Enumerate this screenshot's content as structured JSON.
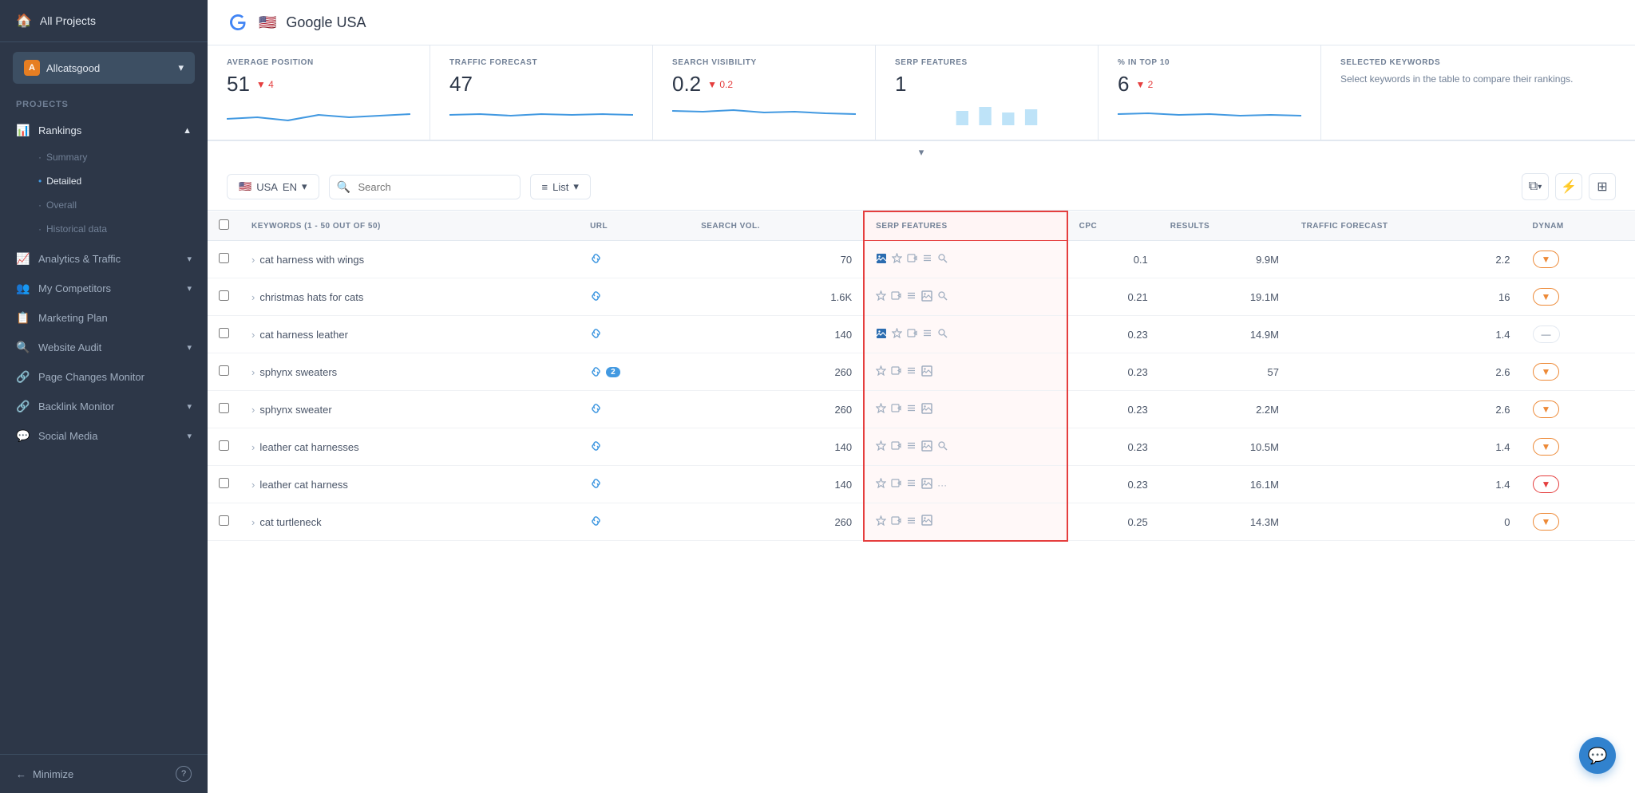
{
  "sidebar": {
    "all_projects_label": "All Projects",
    "project_name": "Allcatsgood",
    "projects_section_label": "PROJECTS",
    "nav_items": [
      {
        "id": "rankings",
        "label": "Rankings",
        "icon": "📊",
        "has_chevron": true,
        "active": true
      },
      {
        "id": "analytics",
        "label": "Analytics & Traffic",
        "icon": "📈",
        "has_chevron": true
      },
      {
        "id": "competitors",
        "label": "My Competitors",
        "icon": "👥",
        "has_chevron": true
      },
      {
        "id": "marketing",
        "label": "Marketing Plan",
        "icon": "📋",
        "has_chevron": false
      },
      {
        "id": "audit",
        "label": "Website Audit",
        "icon": "🔍",
        "has_chevron": true
      },
      {
        "id": "page_monitor",
        "label": "Page Changes Monitor",
        "icon": "🔗",
        "has_chevron": false
      },
      {
        "id": "backlink",
        "label": "Backlink Monitor",
        "icon": "🔗",
        "has_chevron": true
      },
      {
        "id": "social",
        "label": "Social Media",
        "icon": "💬",
        "has_chevron": true
      }
    ],
    "sub_items": [
      {
        "id": "summary",
        "label": "Summary",
        "active": false
      },
      {
        "id": "detailed",
        "label": "Detailed",
        "active": true
      },
      {
        "id": "overall",
        "label": "Overall",
        "active": false
      },
      {
        "id": "historical",
        "label": "Historical data",
        "active": false
      }
    ],
    "minimize_label": "Minimize"
  },
  "header": {
    "engine": "Google",
    "country": "USA",
    "flag": "🇺🇸",
    "title": "Google USA"
  },
  "stats": [
    {
      "label": "AVERAGE POSITION",
      "value": "51",
      "change": "4",
      "change_dir": "down"
    },
    {
      "label": "TRAFFIC FORECAST",
      "value": "47",
      "change": "",
      "change_dir": ""
    },
    {
      "label": "SEARCH VISIBILITY",
      "value": "0.2",
      "change": "0.2",
      "change_dir": "down"
    },
    {
      "label": "SERP FEATURES",
      "value": "1",
      "change": "",
      "change_dir": ""
    },
    {
      "label": "% IN TOP 10",
      "value": "6",
      "change": "2",
      "change_dir": "down"
    },
    {
      "label": "SELECTED KEYWORDS",
      "value": "",
      "helper": "Select keywords in the table to compare their rankings."
    }
  ],
  "toolbar": {
    "engine": "USA",
    "lang": "EN",
    "search_placeholder": "Search",
    "list_label": "List",
    "keywords_count": "KEYWORDS (1 - 50 OUT OF 50)"
  },
  "table": {
    "columns": [
      "",
      "KEYWORDS (1 - 50 OUT OF 50)",
      "URL",
      "SEARCH VOL.",
      "SERP FEATURES",
      "CPC",
      "RESULTS",
      "TRAFFIC FORECAST",
      "DYNAM"
    ],
    "rows": [
      {
        "keyword": "cat harness with wings",
        "url": true,
        "url_badge": null,
        "search_vol": "70",
        "serp": [
          "img",
          "star",
          "video",
          "list",
          "zoom"
        ],
        "serp_active": [
          0
        ],
        "cpc": "0.1",
        "results": "9.9M",
        "traffic": "2.2",
        "dynamic": "orange"
      },
      {
        "keyword": "christmas hats for cats",
        "url": true,
        "url_badge": null,
        "search_vol": "1.6K",
        "serp": [
          "star",
          "video",
          "list",
          "img",
          "zoom"
        ],
        "serp_active": [],
        "cpc": "0.21",
        "results": "19.1M",
        "traffic": "16",
        "dynamic": "orange"
      },
      {
        "keyword": "cat harness leather",
        "url": true,
        "url_badge": null,
        "search_vol": "140",
        "serp": [
          "img",
          "star",
          "video",
          "list",
          "zoom"
        ],
        "serp_active": [
          0
        ],
        "cpc": "0.23",
        "results": "14.9M",
        "traffic": "1.4",
        "dynamic": "none"
      },
      {
        "keyword": "sphynx sweaters",
        "url": true,
        "url_badge": "2",
        "search_vol": "260",
        "serp": [
          "star",
          "video",
          "list",
          "img"
        ],
        "serp_active": [],
        "cpc": "0.23",
        "results": "57",
        "traffic": "2.6",
        "dynamic": "orange"
      },
      {
        "keyword": "sphynx sweater",
        "url": true,
        "url_badge": null,
        "search_vol": "260",
        "serp": [
          "star",
          "video",
          "list",
          "img"
        ],
        "serp_active": [],
        "cpc": "0.23",
        "results": "2.2M",
        "traffic": "2.6",
        "dynamic": "orange"
      },
      {
        "keyword": "leather cat harnesses",
        "url": true,
        "url_badge": null,
        "search_vol": "140",
        "serp": [
          "star",
          "video",
          "list",
          "img",
          "zoom"
        ],
        "serp_active": [],
        "cpc": "0.23",
        "results": "10.5M",
        "traffic": "1.4",
        "dynamic": "orange"
      },
      {
        "keyword": "leather cat harness",
        "url": true,
        "url_badge": null,
        "search_vol": "140",
        "serp": [
          "star",
          "video",
          "list",
          "img",
          "more"
        ],
        "serp_active": [],
        "cpc": "0.23",
        "results": "16.1M",
        "traffic": "1.4",
        "dynamic": "red"
      },
      {
        "keyword": "cat turtleneck",
        "url": true,
        "url_badge": null,
        "search_vol": "260",
        "serp": [
          "star",
          "video",
          "list",
          "img"
        ],
        "serp_active": [],
        "cpc": "0.25",
        "results": "14.3M",
        "traffic": "0",
        "dynamic": "orange"
      }
    ]
  },
  "chat": {
    "icon": "💬"
  }
}
